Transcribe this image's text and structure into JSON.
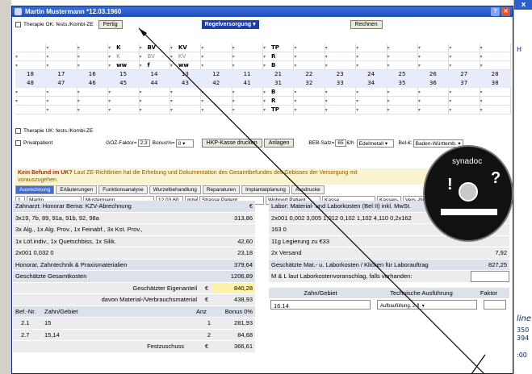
{
  "window": {
    "title": "Martin Mustermann *12.03.1960"
  },
  "toolbar": {
    "therapy_ok_label": "Therapie OK: fests./Kombi-ZE",
    "fertig_label": "Fertig",
    "versorgung_label": "Regelversorgung",
    "rechnen_label": "Rechnen"
  },
  "grid": {
    "upper_rows": [
      [
        "",
        "",
        "",
        "K",
        "BV",
        "KV",
        "",
        "",
        "",
        "",
        "",
        "",
        "",
        "",
        "",
        ""
      ],
      [
        "",
        "",
        "",
        "K",
        "BV",
        "KV",
        "",
        "",
        "",
        "",
        "",
        "",
        "",
        "",
        "",
        ""
      ],
      [
        "",
        "",
        "",
        "ww",
        "f",
        "ww",
        "",
        "",
        "",
        "",
        "",
        "",
        "",
        "",
        "",
        ""
      ]
    ],
    "upper_codes": [
      "TP",
      "R",
      "B"
    ],
    "upper_numbers": [
      "18",
      "17",
      "16",
      "15",
      "14",
      "13",
      "12",
      "11",
      "21",
      "22",
      "23",
      "24",
      "25",
      "26",
      "27",
      "28"
    ],
    "lower_numbers": [
      "48",
      "47",
      "46",
      "45",
      "44",
      "43",
      "42",
      "41",
      "31",
      "32",
      "33",
      "34",
      "35",
      "36",
      "37",
      "38"
    ],
    "lower_codes": [
      "B",
      "R",
      "TP"
    ]
  },
  "options": {
    "therapy_uk_label": "Therapie UK: fests./Kombi-ZE",
    "privatpatient_label": "Privatpatient",
    "goz_label": "GOZ-Faktor=",
    "goz_value": "2,3",
    "bonus_label": "Bonus%=",
    "bonus_value": "0",
    "hkp_button": "HKP-Kasse drucken",
    "anlagen_button": "Anlagen",
    "beb_label": "BEB-Satz=",
    "beb_value": "65",
    "beb_unit": "€/h",
    "material_value": "Edelmetall",
    "bel_label": "Bel-€:",
    "bel_value": "Baden-Württemb."
  },
  "notice": {
    "bold": "Kein Befund im UK?",
    "text": " Laut ZE-Richtlinien hat die Erhebung und Dokumentation des Gesamtbefundes des Gebisses der Versorgung mit",
    "text2": "vorauszugehen."
  },
  "tabs": [
    "Ausrechnung",
    "Erläuterungen",
    "Funktionsanalyse",
    "Wurzelbehandlung",
    "Reparaturen",
    "Implantatplanung",
    "Ausdrucke"
  ],
  "patient": {
    "nr": "1",
    "vorname": "Martin",
    "nachname": "Mustermann",
    "geburt": "12.03.60",
    "geschlecht": "m/w",
    "strasse": "Strasse Patient",
    "wohnort": "Wohnort Patient",
    "kasse": "Kasse",
    "kassen_nr": "Kassen-nr",
    "vers_nr": "Vers.-Nr.",
    "s": "S"
  },
  "left_table": {
    "header_label": "Zahnarzt: Honorar Bema: KZV-Abrechnung",
    "header_unit": "€",
    "rows": [
      {
        "label": "3x19, 7b, 89, 91a, 91b, 92, 98a",
        "value": "313,86"
      },
      {
        "label": "3x Alg., 1x Alg. Prov., 1x Feinabf., 3x Kst. Prov.,",
        "value": ""
      },
      {
        "label": "1x Löf.indiv., 1x Quetschbiss, 1x Silik.",
        "value": "42,60"
      },
      {
        "label": "2x001 0,032 0",
        "value": "23,18"
      },
      {
        "label": "Honorar, Zahntechnik & Praxismaterialien",
        "value": "379,64"
      },
      {
        "label": "Geschätzte Gesamtkosten",
        "value": "1206,89"
      }
    ],
    "eigenanteil_label": "Geschätzter Eigenanteil",
    "eigenanteil_unit": "€",
    "eigenanteil_value": "840,28",
    "material_label": "davon Material-/Verbrauchsmaterial",
    "material_unit": "€",
    "material_value": "438,93",
    "bef_headers": [
      "Bef.-Nr.",
      "Zahn/Gebiet",
      "Anz",
      "Bonus 0%"
    ],
    "bef_rows": [
      {
        "nr": "2.1",
        "zahn": "15",
        "anz": "1",
        "bonus": "281,93"
      },
      {
        "nr": "2.7",
        "zahn": "15,14",
        "anz": "2",
        "bonus": "84,68"
      }
    ],
    "festzuschuss_label": "Festzuschuss",
    "festzuschuss_unit": "€",
    "festzuschuss_value": "366,61"
  },
  "right_table": {
    "header_label": "Labor: Material- und Laborkosten (Bel II) inkl. MwSt.",
    "rows": [
      {
        "label": "2x001 0,002 3,005 1,012 0,102 1,102 4,110 0,2x162",
        "value": ""
      },
      {
        "label": "163 0",
        "value": ""
      },
      {
        "label": "11g Legierung zu €33",
        "value": ""
      },
      {
        "label": "2x Versand",
        "value": "7,92"
      },
      {
        "label": "Geschätzte Mat.- u. Laborkosten / Klicken für Laborauftrag",
        "value": "827,25"
      },
      {
        "label": "M & L laut Laborkostenvoranschlag, falls vorhanden:",
        "value": ""
      }
    ],
    "col_headers": [
      "Zahn/Gebiet",
      "Technische Ausführung",
      "Faktor"
    ],
    "zahn_value": "16.14",
    "ausfuehrung_value": "Aufbaufüllung, 2-fl."
  },
  "overlay": {
    "brand": "synadoc"
  },
  "desktop": {
    "right_labels": [
      "H",
      "line",
      "350",
      "394",
      ":00"
    ]
  }
}
